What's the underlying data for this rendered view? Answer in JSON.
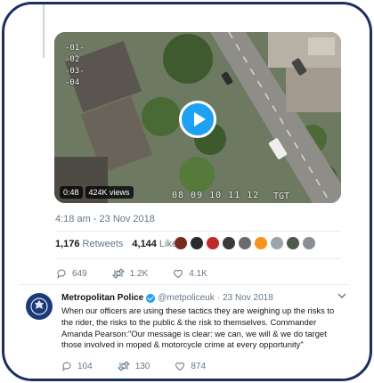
{
  "tweet1": {
    "video": {
      "duration": "0:48",
      "views": "424K views",
      "overlay_timestamp": "08 09 10 11 12",
      "overlay_tgt": "TGT",
      "overlay_ticks": [
        "-01-",
        "-02",
        "-03-",
        "-04"
      ]
    },
    "time_date": "4:18 am - 23 Nov 2018",
    "retweets_count": "1,176",
    "retweets_label": "Retweets",
    "likes_count": "4,144",
    "likes_label": "Likes",
    "liker_avatar_colors": [
      "#7a2a1f",
      "#2b2b2b",
      "#c0282a",
      "#3a3a3a",
      "#6b6b6b",
      "#f7931a",
      "#9aa4ab",
      "#4b5a4a",
      "#8a8f96"
    ],
    "actions": {
      "replies": "649",
      "retweets": "1.2K",
      "likes": "4.1K"
    }
  },
  "tweet2": {
    "name": "Metropolitan Police",
    "handle": "@metpoliceuk",
    "separator": "·",
    "date": "23 Nov 2018",
    "text": "When our officers are using these tactics they are weighing up the risks to the rider, the risks to the public & the risk to themselves. Commander Amanda Pearson:\"Our message is clear: we can, we will & we do target those involved in moped & motorcycle crime at every opportunity\"",
    "actions": {
      "replies": "104",
      "retweets": "130",
      "likes": "874"
    }
  },
  "colors": {
    "accent": "#1da1f2",
    "frame": "#1c2f63",
    "muted": "#657786"
  }
}
